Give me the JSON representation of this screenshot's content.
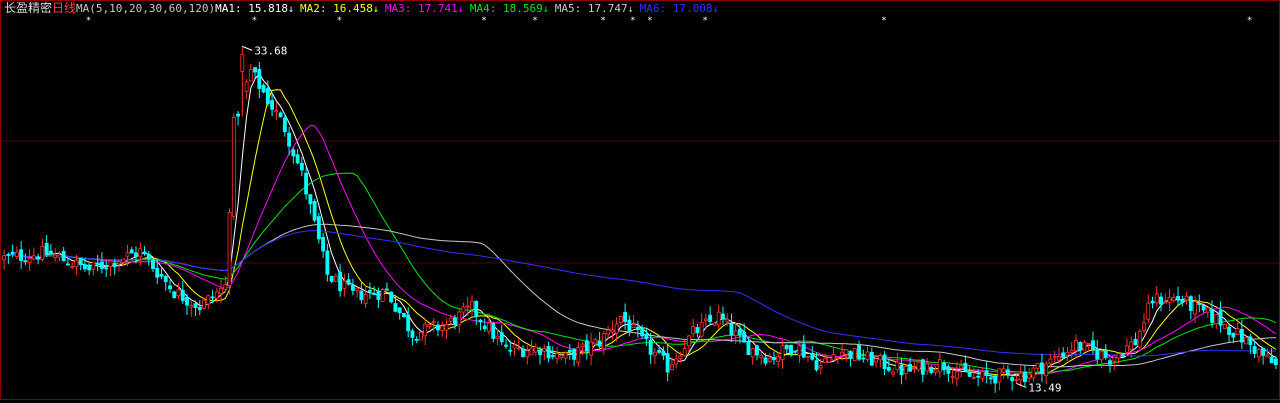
{
  "header": {
    "stock_name": "长盈精密",
    "period": "日线",
    "ma_params": "MA(5,10,20,30,60,120)",
    "ma_values": [
      {
        "label": "MA1:",
        "value": "15.818",
        "color": "#ffffff"
      },
      {
        "label": "MA2:",
        "value": "16.458",
        "color": "#ffff00"
      },
      {
        "label": "MA3:",
        "value": "17.741",
        "color": "#ff00ff"
      },
      {
        "label": "MA4:",
        "value": "18.569",
        "color": "#00e600"
      },
      {
        "label": "MA5:",
        "value": "17.747",
        "color": "#c8c8c8"
      },
      {
        "label": "MA6:",
        "value": "17.008",
        "color": "#3030ff"
      }
    ],
    "ma_value_arrow": "↓"
  },
  "annotations": {
    "high_label": "33.68",
    "low_label": "13.49"
  },
  "colors": {
    "up": "#ff3232",
    "down": "#00ffff",
    "background": "#000000",
    "grid": "#5a0000"
  },
  "chart_data": {
    "type": "candlestick",
    "title": "",
    "y_range": [
      12.5,
      35.5
    ],
    "x_count": 300,
    "high_marker": {
      "index": 56,
      "value": 33.68
    },
    "low_marker": {
      "index": 238,
      "value": 13.49
    },
    "price_path_anchors": [
      [
        0,
        21.0
      ],
      [
        10,
        21.3
      ],
      [
        20,
        20.3
      ],
      [
        32,
        21.4
      ],
      [
        40,
        19.0
      ],
      [
        46,
        18.1
      ],
      [
        52,
        19.3
      ],
      [
        54,
        29.0
      ],
      [
        58,
        32.2
      ],
      [
        62,
        30.5
      ],
      [
        66,
        28.8
      ],
      [
        70,
        26.0
      ],
      [
        76,
        20.0
      ],
      [
        82,
        18.8
      ],
      [
        90,
        19.0
      ],
      [
        96,
        16.5
      ],
      [
        104,
        17.0
      ],
      [
        110,
        18.0
      ],
      [
        118,
        15.5
      ],
      [
        126,
        15.6
      ],
      [
        132,
        15.0
      ],
      [
        140,
        16.0
      ],
      [
        145,
        17.5
      ],
      [
        150,
        16.0
      ],
      [
        156,
        14.5
      ],
      [
        162,
        16.5
      ],
      [
        168,
        17.5
      ],
      [
        174,
        15.8
      ],
      [
        180,
        15.0
      ],
      [
        186,
        15.8
      ],
      [
        192,
        14.5
      ],
      [
        196,
        15.5
      ],
      [
        204,
        14.9
      ],
      [
        212,
        14.2
      ],
      [
        220,
        14.7
      ],
      [
        228,
        13.8
      ],
      [
        236,
        14.0
      ],
      [
        240,
        14.0
      ],
      [
        246,
        14.8
      ],
      [
        252,
        15.8
      ],
      [
        260,
        15.0
      ],
      [
        266,
        16.0
      ],
      [
        270,
        18.5
      ],
      [
        276,
        18.6
      ],
      [
        280,
        18.0
      ],
      [
        286,
        17.2
      ],
      [
        292,
        16.0
      ],
      [
        299,
        14.5
      ]
    ]
  }
}
